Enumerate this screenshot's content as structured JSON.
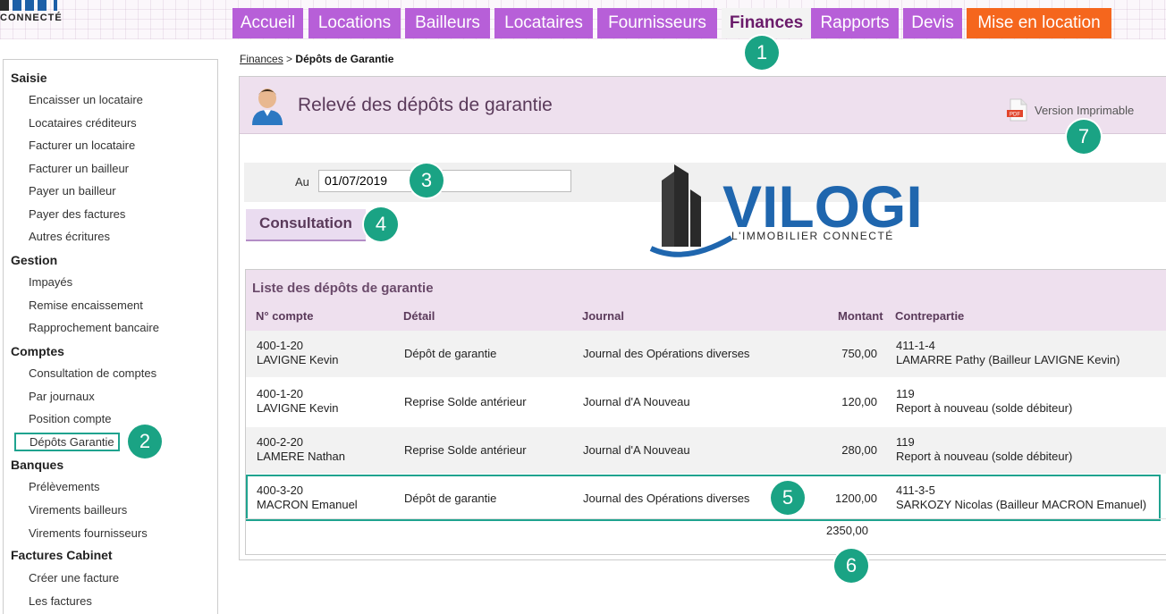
{
  "logo_fragment": {
    "text": "CONNECTÉ"
  },
  "nav": {
    "tabs": [
      {
        "label": "Accueil"
      },
      {
        "label": "Locations"
      },
      {
        "label": "Bailleurs"
      },
      {
        "label": "Locataires"
      },
      {
        "label": "Fournisseurs"
      },
      {
        "label": "Finances"
      },
      {
        "label": "Rapports"
      },
      {
        "label": "Devis"
      },
      {
        "label": "Mise en location"
      }
    ]
  },
  "sidebar": {
    "sections": [
      {
        "title": "Saisie",
        "items": [
          "Encaisser un locataire",
          "Locataires créditeurs",
          "Facturer un locataire",
          "Facturer un bailleur",
          "Payer un bailleur",
          "Payer des factures",
          "Autres écritures"
        ]
      },
      {
        "title": "Gestion",
        "items": [
          "Impayés",
          "Remise encaissement",
          "Rapprochement bancaire"
        ]
      },
      {
        "title": "Comptes",
        "items": [
          "Consultation de comptes",
          "Par journaux",
          "Position compte",
          "Dépôts Garantie"
        ]
      },
      {
        "title": "Banques",
        "items": [
          "Prélèvements",
          "Virements bailleurs",
          "Virements fournisseurs"
        ]
      },
      {
        "title": "Factures Cabinet",
        "items": [
          "Créer une facture",
          "Les factures"
        ]
      }
    ]
  },
  "breadcrumb": {
    "parent": "Finances",
    "separator": ">",
    "current": "Dépôts de Garantie"
  },
  "page": {
    "title": "Relevé des dépôts de garantie",
    "print_label": "Version Imprimable",
    "pdf_text": "PDF"
  },
  "filter": {
    "label": "Au",
    "date_value": "01/07/2019"
  },
  "consult_button": "Consultation",
  "watermark": {
    "brand": "VILOGI",
    "tagline": "L'IMMOBILIER CONNECTÉ"
  },
  "list": {
    "title": "Liste des dépôts de garantie",
    "columns": [
      "N° compte",
      "Détail",
      "Journal",
      "Montant",
      "Contrepartie"
    ],
    "rows": [
      {
        "account": "400-1-20",
        "name": "LAVIGNE Kevin",
        "detail": "Dépôt de garantie",
        "journal": "Journal des Opérations diverses",
        "amount": "750,00",
        "cp_account": "411-1-4",
        "cp_name": "LAMARRE Pathy (Bailleur LAVIGNE Kevin)"
      },
      {
        "account": "400-1-20",
        "name": "LAVIGNE Kevin",
        "detail": "Reprise Solde antérieur",
        "journal": "Journal d'A Nouveau",
        "amount": "120,00",
        "cp_account": "119",
        "cp_name": "Report à nouveau (solde débiteur)"
      },
      {
        "account": "400-2-20",
        "name": "LAMERE Nathan",
        "detail": "Reprise Solde antérieur",
        "journal": "Journal d'A Nouveau",
        "amount": "280,00",
        "cp_account": "119",
        "cp_name": "Report à nouveau (solde débiteur)"
      },
      {
        "account": "400-3-20",
        "name": "MACRON Emanuel",
        "detail": "Dépôt de garantie",
        "journal": "Journal des Opérations diverses",
        "amount": "1200,00",
        "cp_account": "411-3-5",
        "cp_name": "SARKOZY Nicolas (Bailleur MACRON Emanuel)"
      }
    ],
    "total": "2350,00"
  },
  "badges": [
    "1",
    "2",
    "3",
    "4",
    "5",
    "6",
    "7"
  ],
  "colors": {
    "nav_tab": "#b75fd8",
    "nav_orange": "#f5661d",
    "badge": "#1aa384",
    "header_bg": "#eee0ee"
  }
}
